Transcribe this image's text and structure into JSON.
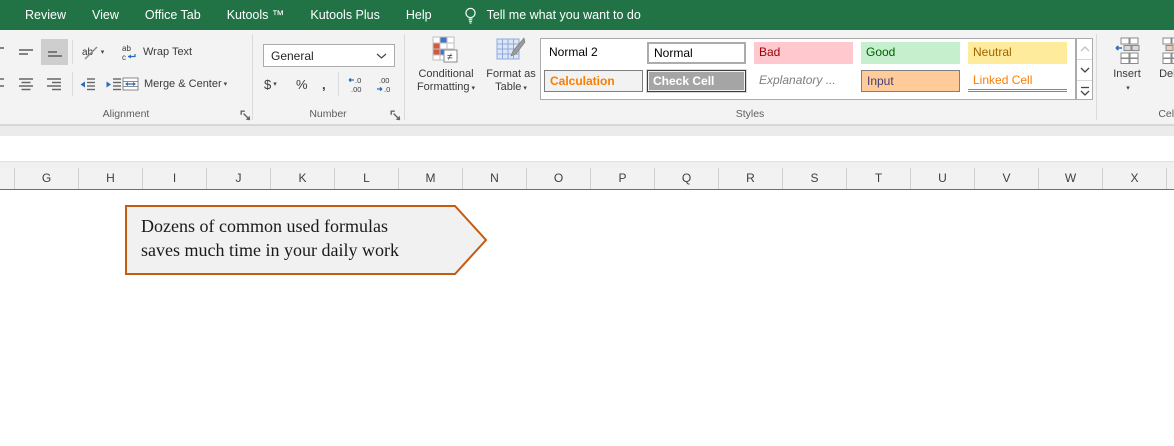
{
  "menu": {
    "tabs": [
      "Review",
      "View",
      "Office Tab",
      "Kutools ™",
      "Kutools Plus",
      "Help"
    ],
    "tell_me": "Tell me what you want to do"
  },
  "ribbon": {
    "alignment": {
      "label": "Alignment",
      "wrap_text": "Wrap Text",
      "merge_center": "Merge & Center"
    },
    "number": {
      "label": "Number",
      "format_value": "General",
      "currency": "$",
      "percent": "%",
      "comma": ","
    },
    "styles": {
      "label": "Styles",
      "conditional_formatting_line1": "Conditional",
      "conditional_formatting_line2": "Formatting",
      "format_as_table_line1": "Format as",
      "format_as_table_line2": "Table",
      "gallery": [
        {
          "label": "Normal 2",
          "bg": "#FFFFFF",
          "fg": "#000000"
        },
        {
          "label": "Normal",
          "bg": "#FFFFFF",
          "fg": "#000000",
          "selected": true
        },
        {
          "label": "Bad",
          "bg": "#FFC7CE",
          "fg": "#9C0006"
        },
        {
          "label": "Good",
          "bg": "#C6EFCE",
          "fg": "#006100"
        },
        {
          "label": "Neutral",
          "bg": "#FFEB9C",
          "fg": "#9C6500"
        },
        {
          "label": "Calculation",
          "bg": "#F2F2F2",
          "fg": "#FA7D00",
          "bold": true,
          "border": "#7F7F7F"
        },
        {
          "label": "Check Cell",
          "bg": "#A5A5A5",
          "fg": "#FFFFFF",
          "bold": true,
          "double_border": "#3F3F3F"
        },
        {
          "label": "Explanatory ...",
          "bg": "#FFFFFF",
          "fg": "#7F7F7F",
          "italic": true
        },
        {
          "label": "Input",
          "bg": "#FFCC99",
          "fg": "#3F3F76",
          "border": "#7F7F7F"
        },
        {
          "label": "Linked Cell",
          "bg": "#FFFFFF",
          "fg": "#FA7D00",
          "underline": "#E26B0A"
        }
      ]
    },
    "cells": {
      "label": "Cells",
      "insert": "Insert",
      "delete": "Delete"
    }
  },
  "sheet": {
    "columns": [
      "G",
      "H",
      "I",
      "J",
      "K",
      "L",
      "M",
      "N",
      "O",
      "P",
      "Q",
      "R",
      "S",
      "T",
      "U",
      "V",
      "W",
      "X"
    ]
  },
  "callout": {
    "line1": "Dozens of common used formulas",
    "line2": "saves much time in your daily work",
    "border_color": "#C55A11",
    "fill_color": "#F1F1F1"
  },
  "colors": {
    "menubar_green": "#217346",
    "ribbon_bg": "#F3F3F3"
  }
}
